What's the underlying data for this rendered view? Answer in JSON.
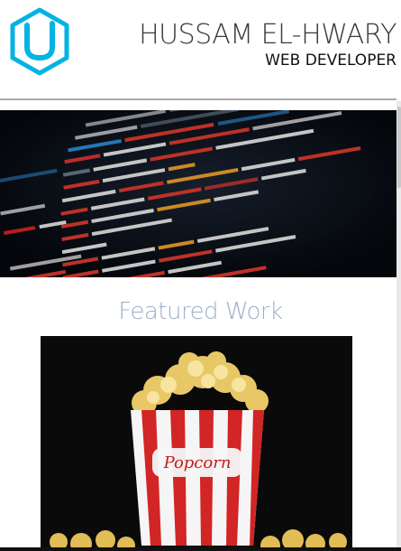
{
  "header": {
    "logo_icon": "udacity-u-logo-icon",
    "name": "HUSSAM EL-HWARY",
    "title": "WEB DEVELOPER",
    "accent": "#02b3e4"
  },
  "hero": {
    "image": "html-source-code-image"
  },
  "featured": {
    "heading": "Featured Work",
    "heading_color": "#9cb0c7",
    "items": [
      {
        "image": "popcorn-box-image",
        "label": "Popcorn"
      }
    ]
  }
}
